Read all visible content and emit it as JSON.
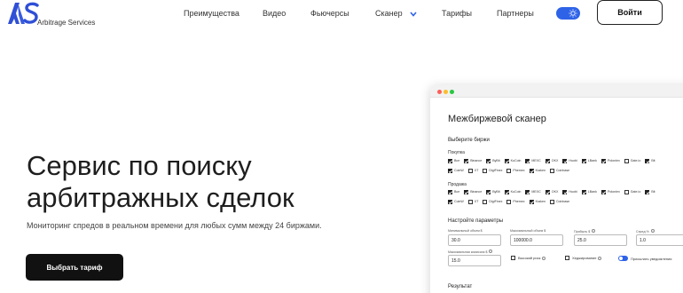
{
  "header": {
    "logo_text": "Arbitrage Services",
    "nav": [
      {
        "label": "Преимущества"
      },
      {
        "label": "Видео"
      },
      {
        "label": "Фьючерсы"
      },
      {
        "label": "Сканер"
      },
      {
        "label": "Тарифы"
      },
      {
        "label": "Партнеры"
      }
    ],
    "login_label": "Войти"
  },
  "hero": {
    "title_line1": "Сервис по поиску",
    "title_line2": "арбитражных сделок",
    "subtitle": "Мониторинг спредов в реальном времени для любых сумм между 24 биржами.",
    "cta_label": "Выбрать тариф"
  },
  "scanner": {
    "title": "Межбиржевой сканер",
    "choose_exchanges": "Выберите биржи",
    "buy_label": "Покупка",
    "sell_label": "Продажа",
    "exchanges_row1": [
      {
        "name": "Все",
        "checked": true
      },
      {
        "name": "Binance",
        "checked": true
      },
      {
        "name": "ByBit",
        "checked": true
      },
      {
        "name": "KuCoin",
        "checked": true
      },
      {
        "name": "MEXC",
        "checked": true
      },
      {
        "name": "OKX",
        "checked": true
      },
      {
        "name": "Huobi",
        "checked": true
      },
      {
        "name": "LBank",
        "checked": true
      },
      {
        "name": "Poloniex",
        "checked": true
      },
      {
        "name": "Gate.io",
        "checked": false
      },
      {
        "name": "Bit",
        "checked": true
      }
    ],
    "exchanges_row2": [
      {
        "name": "CoinW",
        "checked": true
      },
      {
        "name": "XT",
        "checked": false
      },
      {
        "name": "DigiFinex",
        "checked": false
      },
      {
        "name": "Phemex",
        "checked": false
      },
      {
        "name": "Kraken",
        "checked": true
      },
      {
        "name": "Coinbase",
        "checked": false
      }
    ],
    "params_label": "Настройте параметры",
    "params": [
      {
        "label": "Минимальный объем $",
        "value": "30.0"
      },
      {
        "label": "Максимальный объем $",
        "value": "100000.0"
      },
      {
        "label": "Прибыль $",
        "value": "25.0"
      },
      {
        "label": "Спред %",
        "value": "1.0"
      }
    ],
    "param_fee": {
      "label": "Максимальная комиссия $",
      "value": "15.0"
    },
    "options": [
      {
        "label": "Высокий риск",
        "type": "checkbox",
        "checked": false
      },
      {
        "label": "Хеджирование",
        "type": "checkbox",
        "checked": false
      },
      {
        "label": "Присылать уведомления",
        "type": "toggle",
        "checked": true
      }
    ],
    "result_label": "Результат"
  },
  "colors": {
    "accent": "#2e63e8",
    "logo_blue": "#2f4fd6",
    "dark": "#111111",
    "dot_red": "#ff5f57",
    "dot_yellow": "#febc2e",
    "dot_green": "#28c840"
  }
}
